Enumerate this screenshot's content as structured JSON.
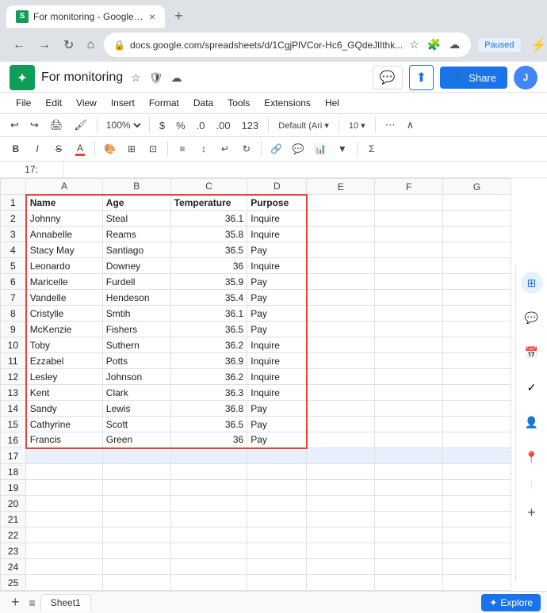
{
  "browser": {
    "tab_title": "For monitoring - Google Sheets",
    "url": "docs.google.com/spreadsheets/d/1CgjPlVCor-Hc6_GQdeJlIthk...",
    "paused_label": "Paused"
  },
  "sheets": {
    "title": "For monitoring",
    "menu": [
      "File",
      "Edit",
      "View",
      "Insert",
      "Format",
      "Data",
      "Tools",
      "Extensions",
      "Hel"
    ],
    "zoom": "100%",
    "share_label": "Share",
    "sheet_tab": "Sheet1",
    "explore_label": "Explore",
    "cell_ref": "17:"
  },
  "columns": [
    "A",
    "B",
    "C",
    "D",
    "E",
    "F",
    "G"
  ],
  "headers": [
    "Name",
    "Age",
    "Temperature",
    "Purpose"
  ],
  "rows": [
    {
      "num": 1,
      "cols": [
        "Name",
        "Age",
        "Temperature",
        "Purpose",
        "",
        "",
        ""
      ]
    },
    {
      "num": 2,
      "cols": [
        "Johnny",
        "Steal",
        "36.1",
        "Inquire",
        "",
        "",
        ""
      ]
    },
    {
      "num": 3,
      "cols": [
        "Annabelle",
        "Reams",
        "35.8",
        "Inquire",
        "",
        "",
        ""
      ]
    },
    {
      "num": 4,
      "cols": [
        "Stacy May",
        "Santiago",
        "36.5",
        "Pay",
        "",
        "",
        ""
      ]
    },
    {
      "num": 5,
      "cols": [
        "Leonardo",
        "Downey",
        "36",
        "Inquire",
        "",
        "",
        ""
      ]
    },
    {
      "num": 6,
      "cols": [
        "Maricelle",
        "Furdell",
        "35.9",
        "Pay",
        "",
        "",
        ""
      ]
    },
    {
      "num": 7,
      "cols": [
        "Vandelle",
        "Hendeson",
        "35.4",
        "Pay",
        "",
        "",
        ""
      ]
    },
    {
      "num": 8,
      "cols": [
        "Cristylle",
        "Smtih",
        "36.1",
        "Pay",
        "",
        "",
        ""
      ]
    },
    {
      "num": 9,
      "cols": [
        "McKenzie",
        "Fishers",
        "36.5",
        "Pay",
        "",
        "",
        ""
      ]
    },
    {
      "num": 10,
      "cols": [
        "Toby",
        "Suthern",
        "36.2",
        "Inquire",
        "",
        "",
        ""
      ]
    },
    {
      "num": 11,
      "cols": [
        "Ezzabel",
        "Potts",
        "36.9",
        "Inquire",
        "",
        "",
        ""
      ]
    },
    {
      "num": 12,
      "cols": [
        "Lesley",
        "Johnson",
        "36.2",
        "Inquire",
        "",
        "",
        ""
      ]
    },
    {
      "num": 13,
      "cols": [
        "Kent",
        "Clark",
        "36.3",
        "Inquire",
        "",
        "",
        ""
      ]
    },
    {
      "num": 14,
      "cols": [
        "Sandy",
        "Lewis",
        "36.8",
        "Pay",
        "",
        "",
        ""
      ]
    },
    {
      "num": 15,
      "cols": [
        "Cathyrine",
        "Scott",
        "36.5",
        "Pay",
        "",
        "",
        ""
      ]
    },
    {
      "num": 16,
      "cols": [
        "Francis",
        "Green",
        "36",
        "Pay",
        "",
        "",
        ""
      ]
    },
    {
      "num": 17,
      "cols": [
        "",
        "",
        "",
        "",
        "",
        "",
        ""
      ]
    },
    {
      "num": 18,
      "cols": [
        "",
        "",
        "",
        "",
        "",
        "",
        ""
      ]
    },
    {
      "num": 19,
      "cols": [
        "",
        "",
        "",
        "",
        "",
        "",
        ""
      ]
    },
    {
      "num": 20,
      "cols": [
        "",
        "",
        "",
        "",
        "",
        "",
        ""
      ]
    },
    {
      "num": 21,
      "cols": [
        "",
        "",
        "",
        "",
        "",
        "",
        ""
      ]
    },
    {
      "num": 22,
      "cols": [
        "",
        "",
        "",
        "",
        "",
        "",
        ""
      ]
    },
    {
      "num": 23,
      "cols": [
        "",
        "",
        "",
        "",
        "",
        "",
        ""
      ]
    },
    {
      "num": 24,
      "cols": [
        "",
        "",
        "",
        "",
        "",
        "",
        ""
      ]
    },
    {
      "num": 25,
      "cols": [
        "",
        "",
        "",
        "",
        "",
        "",
        ""
      ]
    }
  ]
}
